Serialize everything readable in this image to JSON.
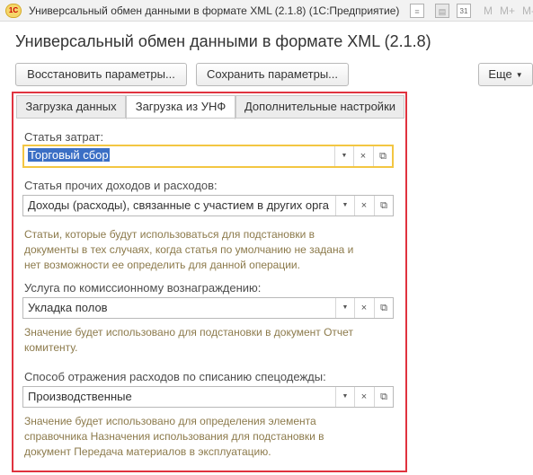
{
  "window": {
    "app_logo_text": "1С",
    "title": "Универсальный обмен данными в формате XML (2.1.8)  (1С:Предприятие)",
    "toolbar_icons": [
      "document-icon",
      "print-icon",
      "calendar-icon"
    ],
    "toolbar_text": [
      "M",
      "M+",
      "M-"
    ],
    "calendar_day": "31"
  },
  "header": {
    "title": "Универсальный обмен данными в формате XML (2.1.8)"
  },
  "buttons": {
    "restore": "Восстановить параметры...",
    "save": "Сохранить параметры...",
    "more": "Еще"
  },
  "tabs": [
    {
      "label": "Загрузка данных",
      "active": false
    },
    {
      "label": "Загрузка из УНФ",
      "active": true
    },
    {
      "label": "Дополнительные настройки",
      "active": false
    }
  ],
  "form": {
    "expense_item": {
      "label": "Статья затрат:",
      "value": "Торговый сбор"
    },
    "other_income_expense": {
      "label": "Статья прочих доходов и расходов:",
      "value": "Доходы (расходы), связанные с участием в других организациях"
    },
    "other_hint": [
      "Статьи, которые будут использоваться для подстановки в",
      "документы в тех случаях, когда статья по умолчанию не задана и",
      "нет возможности ее определить для данной операции."
    ],
    "commission_service": {
      "label": "Услуга по комиссионному вознаграждению:",
      "value": "Укладка полов"
    },
    "commission_hint": [
      "Значение будет использовано для подстановки в документ Отчет",
      "комитенту."
    ],
    "workwear_method": {
      "label": "Способ отражения расходов по списанию спецодежды:",
      "value": "Производственные"
    },
    "workwear_hint": [
      "Значение будет использовано для определения элемента",
      "справочника Назначения использования для подстановки в",
      "документ Передача материалов в эксплуатацию."
    ]
  },
  "colors": {
    "highlight_frame": "#e0333f",
    "focus_border": "#f3c642",
    "selection": "#3b6fc5",
    "hint_text": "#8c7a4b"
  }
}
